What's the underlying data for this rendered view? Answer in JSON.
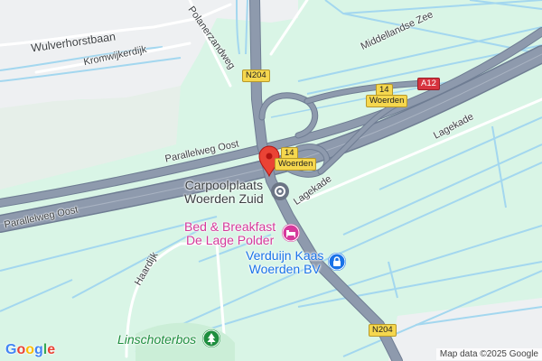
{
  "map": {
    "roads": {
      "wulverhorstbaan": "Wulverhorstbaan",
      "kromwijkerdijk": "Kromwijkerdijk",
      "polanerzandweg": "Polanerzandweg",
      "middellandse_zee": "Middellandse Zee",
      "parallelweg_oost_1": "Parallelweg Oost",
      "parallelweg_oost_2": "Parallelweg Oost",
      "lagekade_1": "Lagekade",
      "lagekade_2": "Lagekade",
      "haardijk": "Haardijk"
    },
    "shields": {
      "n204_top": "N204",
      "n204_bottom": "N204",
      "a12": "A12",
      "exit_14_top": "14",
      "exit_woerden_top": "Woerden",
      "exit_14_center": "14",
      "exit_woerden_center": "Woerden"
    },
    "pois": {
      "carpool": "Carpoolplaats\nWoerden Zuid",
      "bnb": "Bed & Breakfast\nDe Lage Polder",
      "verduijn": "Verduijn Kaas\nWoerden BV",
      "linschoterbos": "Linschoterbos"
    },
    "icons": {
      "marker": "map-pin-icon",
      "carpool": "carpool-target-icon",
      "bnb": "bed-icon",
      "verduijn": "lock-bag-icon",
      "park": "tree-icon"
    },
    "colors": {
      "land_green": "#d9f5e6",
      "urban_gray": "#eef0f2",
      "water": "#a3d7ef",
      "highway": "#8e9aad",
      "marker_red": "#ea4335",
      "poi_pink": "#d6399b",
      "poi_blue": "#1a73e8",
      "park_green": "#1e8e3e"
    }
  },
  "branding": {
    "logo": "Google",
    "logo_letters": [
      "G",
      "o",
      "o",
      "g",
      "l",
      "e"
    ],
    "attribution": "Map data ©2025 Google"
  }
}
